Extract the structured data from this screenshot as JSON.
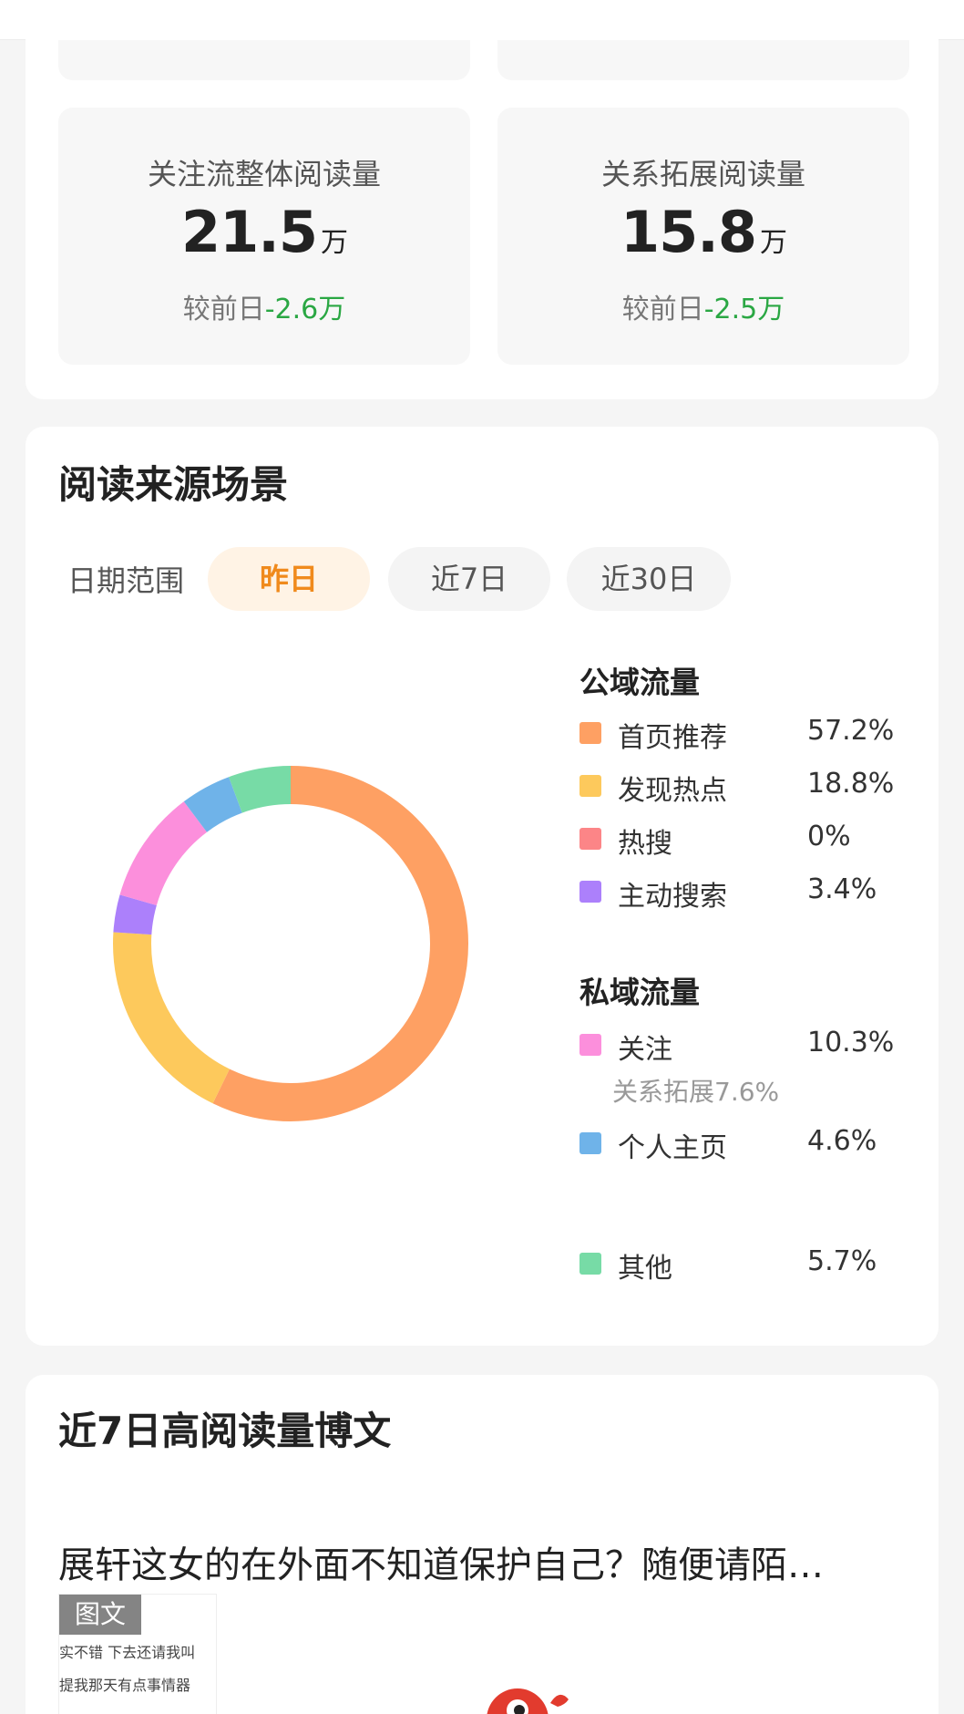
{
  "stats": [
    {
      "label": "关注流整体阅读量",
      "value": "21.5",
      "unit": "万",
      "delta_prefix": "较前日",
      "delta": "-2.6万"
    },
    {
      "label": "关系拓展阅读量",
      "value": "15.8",
      "unit": "万",
      "delta_prefix": "较前日",
      "delta": "-2.5万"
    }
  ],
  "source": {
    "title": "阅读来源场景",
    "range_label": "日期范围",
    "ranges": [
      "昨日",
      "近7日",
      "近30日"
    ],
    "selected_range": "昨日",
    "public_title": "公域流量",
    "private_title": "私域流量",
    "public_items": [
      {
        "name": "首页推荐",
        "pct": "57.2%",
        "color": "#fea063"
      },
      {
        "name": "发现热点",
        "pct": "18.8%",
        "color": "#fdc95c"
      },
      {
        "name": "热搜",
        "pct": "0%",
        "color": "#fc8587"
      },
      {
        "name": "主动搜索",
        "pct": "3.4%",
        "color": "#ac80fb"
      }
    ],
    "private_items": [
      {
        "name": "关注",
        "pct": "10.3%",
        "color": "#fc8fdc",
        "sub": "关系拓展7.6%"
      },
      {
        "name": "个人主页",
        "pct": "4.6%",
        "color": "#6fb3e9"
      }
    ],
    "other_item": {
      "name": "其他",
      "pct": "5.7%",
      "color": "#77dba6"
    }
  },
  "chart_data": {
    "type": "pie",
    "donut": true,
    "categories": [
      "首页推荐",
      "发现热点",
      "热搜",
      "主动搜索",
      "关注",
      "个人主页",
      "其他"
    ],
    "values": [
      57.2,
      18.8,
      0,
      3.4,
      10.3,
      4.6,
      5.7
    ],
    "colors": [
      "#fea063",
      "#fdc95c",
      "#fc8587",
      "#ac80fb",
      "#fc8fdc",
      "#6fb3e9",
      "#77dba6"
    ],
    "legend": "right"
  },
  "posts": {
    "title": "近7日高阅读量博文",
    "items": [
      {
        "title": "展轩这女的在外面不知道保护自己？随便请陌…",
        "tag": "图文",
        "thumb_lines": [
          "实不错 下去还请我叫",
          "提我那天有点事情器"
        ]
      }
    ]
  }
}
